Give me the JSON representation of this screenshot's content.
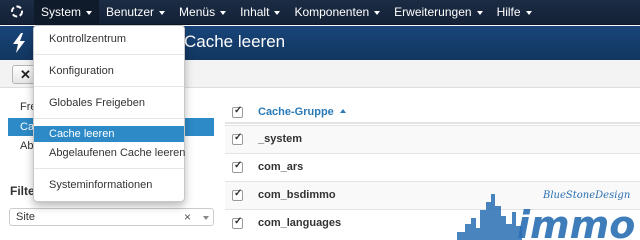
{
  "nav": {
    "items": [
      "System",
      "Benutzer",
      "Menüs",
      "Inhalt",
      "Komponenten",
      "Erweiterungen",
      "Hilfe"
    ],
    "active_index": 0
  },
  "title": {
    "text": "Cache leeren"
  },
  "toolbar": {
    "button_icon": "close-icon"
  },
  "system_menu": {
    "items": [
      "Kontrollzentrum",
      "Konfiguration",
      "Globales Freigeben",
      "Cache leeren",
      "Abgelaufenen Cache leeren",
      "Systeminformationen"
    ],
    "active_item": "Cache leeren"
  },
  "sidebar": {
    "items": [
      "Fre",
      "Cac",
      "Abg"
    ],
    "active_index": 1
  },
  "filter": {
    "heading": "Filte",
    "select_value": "Site",
    "clear_glyph": "×"
  },
  "table": {
    "header": "Cache-Gruppe",
    "sort": "ascending",
    "rows": [
      "_system",
      "com_ars",
      "com_bsdimmo",
      "com_languages"
    ]
  },
  "watermark": {
    "brand_script": "BlueStoneDesign",
    "brand_word": "immo"
  },
  "colors": {
    "navbar": "#1b2c44",
    "titlebar": "#18457a",
    "accent": "#2d8ac7",
    "link": "#2a7ab8"
  }
}
